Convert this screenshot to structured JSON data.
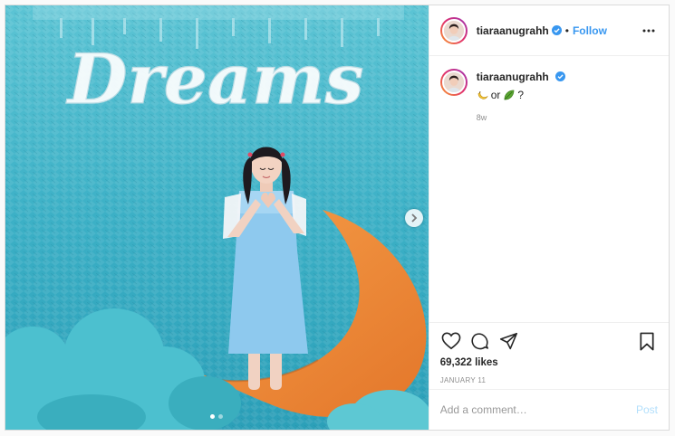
{
  "post": {
    "username": "tiaraanugrahh",
    "follow_label": "Follow",
    "separator": "•",
    "sign_text": "Dreams",
    "caption": {
      "username": "tiaraanugrahh",
      "connector": "or",
      "suffix": "?",
      "emoji_1": "banana-emoji",
      "emoji_2": "leaf-emoji",
      "time": "8w"
    },
    "likes": "69,322 likes",
    "date": "JANUARY 11",
    "comment_placeholder": "Add a comment…",
    "post_label": "Post",
    "carousel": {
      "count": 2,
      "active": 1
    }
  },
  "icons": {
    "verified": "verified-badge-icon",
    "more": "more-options-icon",
    "like": "heart-icon",
    "comment": "comment-icon",
    "share": "share-icon",
    "save": "bookmark-icon",
    "next": "chevron-right-icon"
  },
  "colors": {
    "link": "#3897f0",
    "post_disabled": "#b2dffc",
    "verified": "#3897f0",
    "wall": "#3fb4c7",
    "moon": "#f08a33",
    "dress": "#8ec9ee"
  }
}
